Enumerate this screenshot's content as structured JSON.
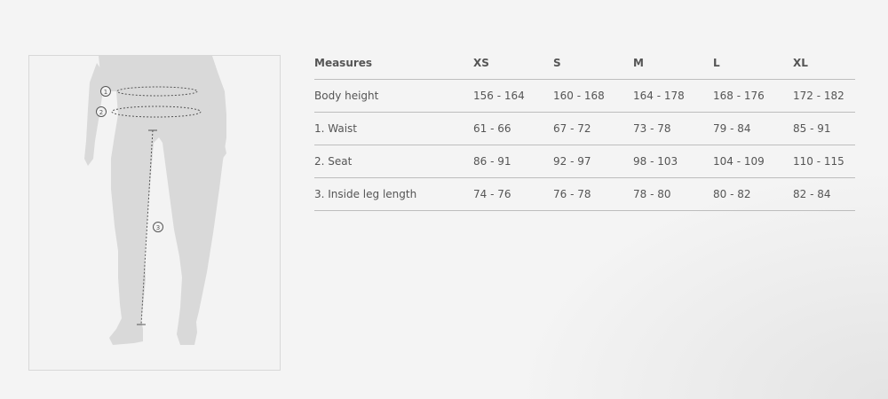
{
  "figure": {
    "markers": [
      "1",
      "2",
      "3"
    ]
  },
  "size_table": {
    "header_measures": "Measures",
    "sizes": [
      "XS",
      "S",
      "M",
      "L",
      "XL"
    ],
    "rows": [
      {
        "label": "Body height",
        "values": [
          "156 - 164",
          "160 - 168",
          "164 - 178",
          "168 - 176",
          "172 - 182"
        ]
      },
      {
        "label": "1. Waist",
        "values": [
          "61 - 66",
          "67 - 72",
          "73 - 78",
          "79 - 84",
          "85 - 91"
        ]
      },
      {
        "label": "2. Seat",
        "values": [
          "86 - 91",
          "92 - 97",
          "98 - 103",
          "104 - 109",
          "110 - 115"
        ]
      },
      {
        "label": "3. Inside leg length",
        "values": [
          "74 - 76",
          "76 - 78",
          "78 - 80",
          "80 - 82",
          "82 - 84"
        ]
      }
    ]
  }
}
